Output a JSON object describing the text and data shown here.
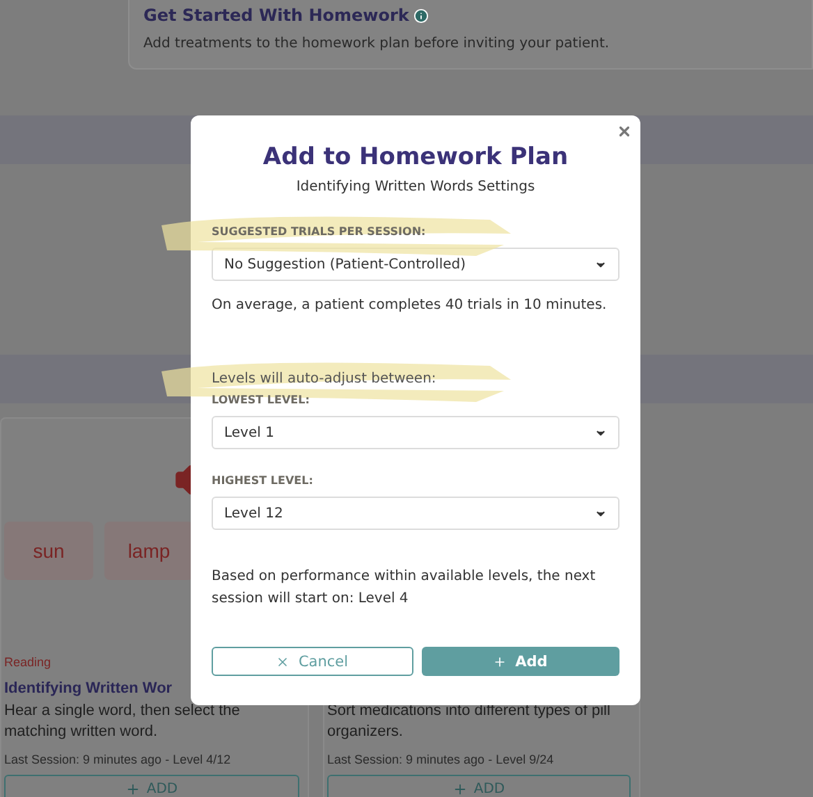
{
  "header": {
    "title": "Get Started With Homework",
    "text": "Add treatments to the homework plan before inviting your patient."
  },
  "cards": [
    {
      "kind": "reading",
      "tiles": [
        "sun",
        "lamp"
      ],
      "category": "Reading",
      "title": "Identifying Written Wor",
      "description": "Hear a single word, then select the matching written word.",
      "last_session": "Last Session: 9 minutes ago - Level 4/12",
      "button": "ADD"
    },
    {
      "kind": "plain",
      "description": "Sort medications into different types of pill organizers.",
      "last_session": "Last Session: 9 minutes ago - Level 9/24",
      "button": "ADD"
    }
  ],
  "modal": {
    "title": "Add to Homework Plan",
    "subtitle": "Identifying Written Words Settings",
    "blocks": [
      {
        "kind": "label",
        "text": "SUGGESTED TRIALS PER SESSION:",
        "highlighted": true
      },
      {
        "kind": "select",
        "value": "No Suggestion (Patient-Controlled)"
      },
      {
        "kind": "note",
        "text": "On average, a patient completes 40 trials in 10 minutes."
      },
      {
        "kind": "intro",
        "text": "Levels will auto-adjust between:",
        "highlighted": true
      },
      {
        "kind": "label",
        "text": "LOWEST LEVEL:",
        "highlighted": false
      },
      {
        "kind": "select",
        "value": "Level 1"
      },
      {
        "kind": "label",
        "text": "HIGHEST LEVEL:",
        "highlighted": false
      },
      {
        "kind": "select",
        "value": "Level 12"
      },
      {
        "kind": "summary",
        "text": "Based on performance within available levels, the next session will start on: Level 4"
      }
    ],
    "cancel": "Cancel",
    "confirm": "Add"
  }
}
